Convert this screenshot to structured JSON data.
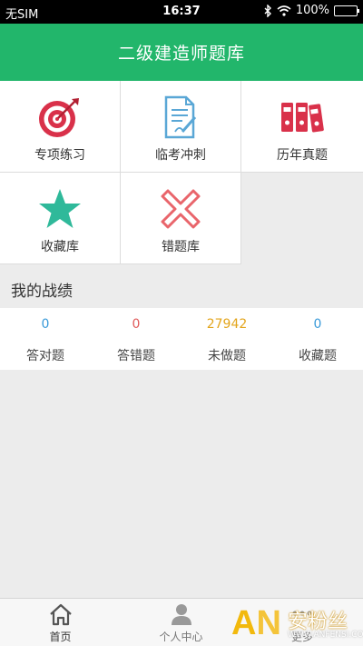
{
  "status_bar": {
    "carrier": "无SIM",
    "time": "16:37",
    "battery": "100%"
  },
  "header": {
    "title": "二级建造师题库"
  },
  "menu": {
    "items": [
      {
        "label": "专项练习",
        "icon": "target-icon"
      },
      {
        "label": "临考冲刺",
        "icon": "document-pen-icon"
      },
      {
        "label": "历年真题",
        "icon": "binders-icon"
      },
      {
        "label": "收藏库",
        "icon": "star-icon"
      },
      {
        "label": "错题库",
        "icon": "cross-icon"
      }
    ]
  },
  "section": {
    "title": "我的战绩"
  },
  "stats": [
    {
      "value": "0",
      "label": "答对题",
      "color": "#3a9ad9"
    },
    {
      "value": "0",
      "label": "答错题",
      "color": "#e05a5a"
    },
    {
      "value": "27942",
      "label": "未做题",
      "color": "#e3a51c"
    },
    {
      "value": "0",
      "label": "收藏题",
      "color": "#3a9ad9"
    }
  ],
  "tabbar": {
    "items": [
      {
        "label": "首页",
        "icon": "home-icon"
      },
      {
        "label": "个人中心",
        "icon": "user-icon"
      },
      {
        "label": "更多",
        "icon": "more-icon"
      }
    ]
  },
  "watermark": {
    "logo": "AN",
    "name": "安粉丝",
    "url": "WWW.ANFENSI.COM"
  },
  "colors": {
    "brand": "#22b66b",
    "icon_red": "#d9314a",
    "icon_teal": "#2fb99a",
    "icon_blue": "#5aa7d6",
    "icon_pink": "#e9656b"
  }
}
